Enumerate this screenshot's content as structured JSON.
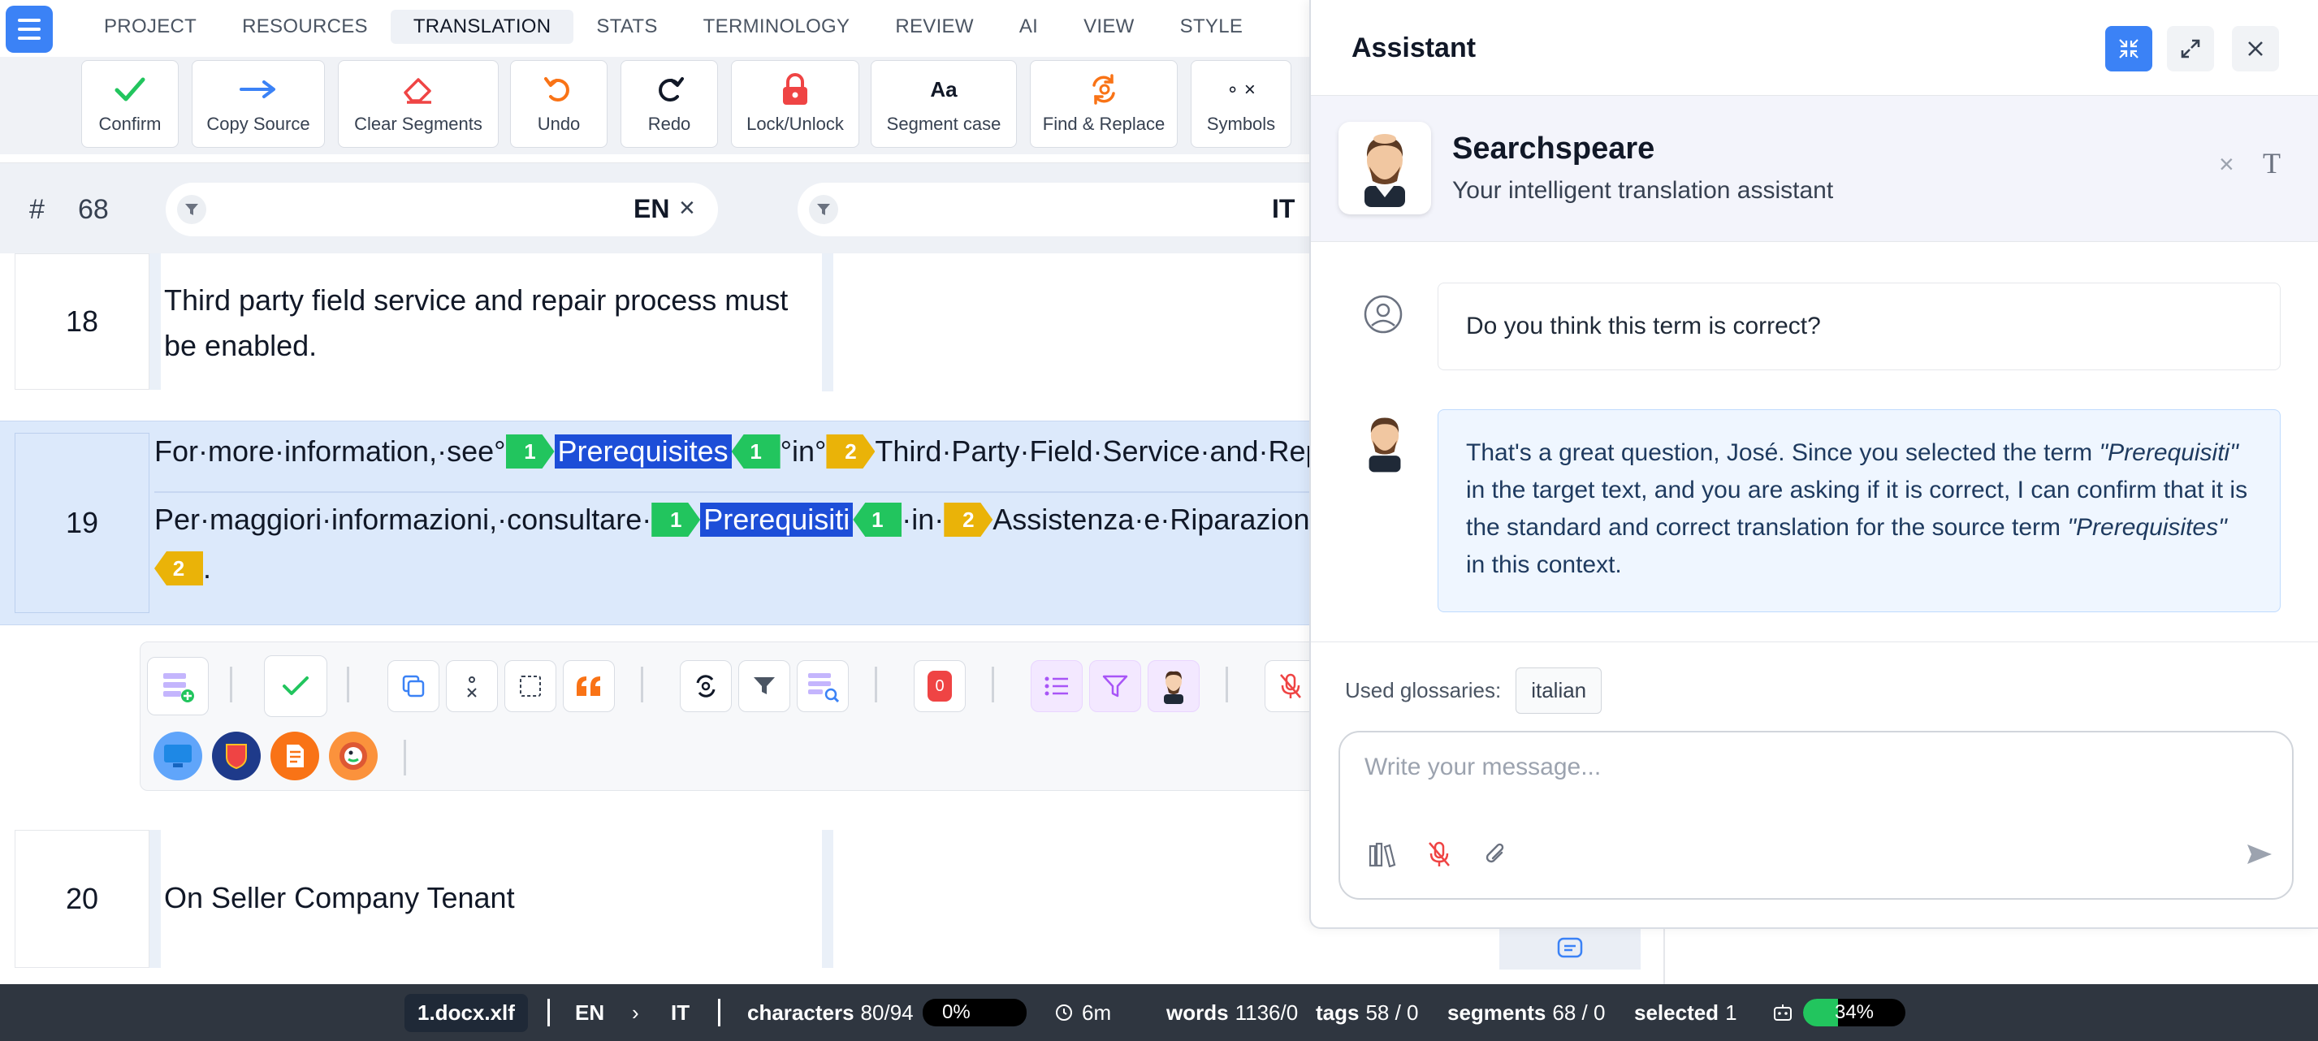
{
  "tabs": [
    "PROJECT",
    "RESOURCES",
    "TRANSLATION",
    "STATS",
    "TERMINOLOGY",
    "REVIEW",
    "AI",
    "VIEW",
    "STYLE"
  ],
  "active_tab": "TRANSLATION",
  "ribbon": {
    "confirm": "Confirm",
    "copy_source": "Copy Source",
    "clear_segments": "Clear Segments",
    "undo": "Undo",
    "redo": "Redo",
    "lock_unlock": "Lock/Unlock",
    "segment_case": "Segment case",
    "segment_case_glyph": "Aa",
    "find_replace": "Find & Replace",
    "symbols": "Symbols",
    "symbols_glyph": "∘ ×"
  },
  "header": {
    "hash": "#",
    "segment_count": "68",
    "source_lang": "EN",
    "target_lang": "IT",
    "clear_glyph": "×"
  },
  "segments": {
    "s18": {
      "num": "18",
      "source": "Third party field service and repair process must be enabled."
    },
    "s19": {
      "num": "19",
      "src_a": "For·more·information,·see°",
      "src_hl": "Prerequisites",
      "src_b": "°in°",
      "src_c": "Third·Party·Field·Service·and·Repai",
      "tgt_a": "Per·maggiori·informazioni,·consultare·",
      "tgt_hl": "Prerequisiti",
      "tgt_b": "·in·",
      "tgt_c": "Assistenza·e·Riparazione",
      "tgt_end": ".",
      "tag1": "1",
      "tag2": "2"
    },
    "s20": {
      "num": "20",
      "source": "On Seller Company Tenant"
    }
  },
  "toolbar": {
    "counter_badge": "0"
  },
  "assistant": {
    "title": "Assistant",
    "bot_name": "Searchspeare",
    "bot_subtitle": "Your intelligent translation assistant",
    "card_close": "×",
    "card_font": "T",
    "user_message": "Do you think this term is correct?",
    "bot_message_1": "That's a great question, José. Since you selected the term ",
    "bot_term_target": "\"Prerequisiti\"",
    "bot_message_2": " in the target text, and you are asking if it is correct, I can confirm that it is the standard and correct translation for the source term ",
    "bot_term_source": "\"Prerequisites\"",
    "bot_message_3": " in this context.",
    "glossaries_label": "Used glossaries:",
    "glossary": "italian",
    "placeholder": "Write your message..."
  },
  "status": {
    "file": "1.docx.xlf",
    "src_lang": "EN",
    "arrow": "›",
    "tgt_lang": "IT",
    "characters_label": "characters",
    "characters_value": "80/94",
    "progress": "0%",
    "time": "6m",
    "words_label": "words",
    "words_value": "1136/0",
    "tags_label": "tags",
    "tags_value": "58 / 0",
    "segments_label": "segments",
    "segments_value": "68 / 0",
    "selected_label": "selected",
    "selected_value": "1",
    "ai_progress": "34%",
    "ai_progress_fraction": 0.34
  },
  "colors": {
    "accent": "#3b82f6",
    "tag_green": "#22c55e",
    "tag_yellow": "#eab308",
    "highlight": "#1d4ed8",
    "row_selected": "#dce9fb",
    "status_bg": "#2f3640"
  }
}
